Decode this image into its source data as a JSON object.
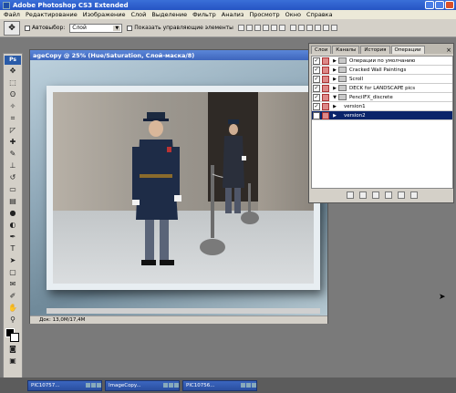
{
  "app": {
    "title": "Adobe Photoshop CS3 Extended"
  },
  "menu": [
    "Файл",
    "Редактирование",
    "Изображение",
    "Слой",
    "Выделение",
    "Фильтр",
    "Анализ",
    "Просмотр",
    "Окно",
    "Справка"
  ],
  "options": {
    "autoselect_label": "Автовыбор:",
    "autoselect_value": "Слой",
    "show_transform_label": "Показать управляющие элементы"
  },
  "document": {
    "title": "ageCopy @ 25% (Hue/Saturation, Слой-маска/8)",
    "status_zoom": "",
    "status_doc": "Док: 13,0M/17,4M"
  },
  "actions_panel": {
    "tabs": [
      "Слои",
      "Каналы",
      "История",
      "Операции"
    ],
    "active_tab": "Операции",
    "rows": [
      {
        "label": "Операции по умолчанию",
        "type": "set"
      },
      {
        "label": "Cracked Wall Paintings",
        "type": "set"
      },
      {
        "label": "Scroll",
        "type": "set"
      },
      {
        "label": "DECK for LANDSCAPE pics",
        "type": "set"
      },
      {
        "label": "PencilFX_discrete",
        "type": "set-open"
      },
      {
        "label": "version1",
        "type": "action"
      },
      {
        "label": "version2",
        "type": "action-selected"
      }
    ]
  },
  "taskbar": {
    "items": [
      "PIC10757...",
      "ImageCopy...",
      "PIC10756..."
    ]
  }
}
